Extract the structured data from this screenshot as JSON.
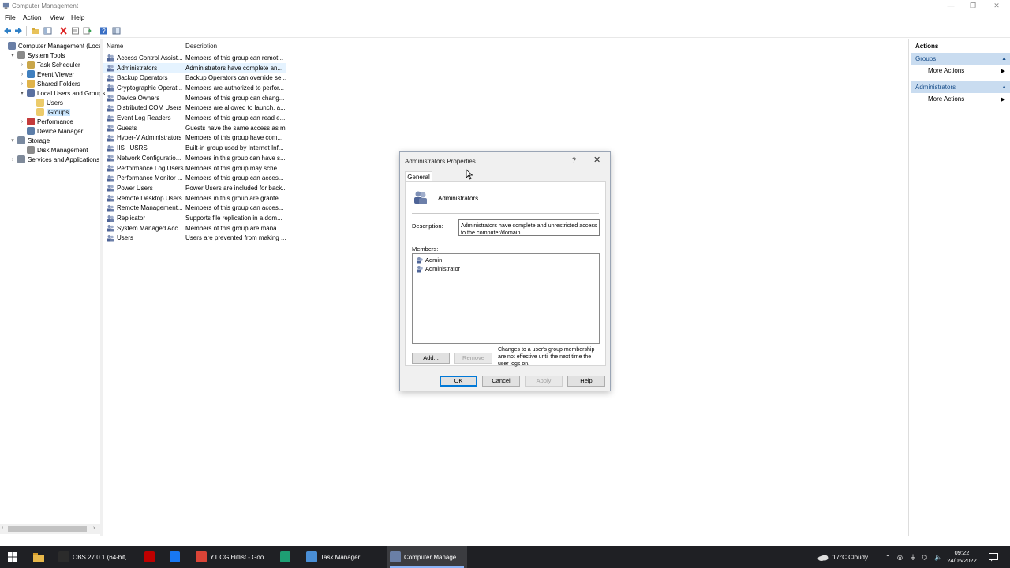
{
  "window": {
    "title": "Computer Management",
    "controls": [
      "—",
      "❐",
      "✕"
    ]
  },
  "menu": [
    "File",
    "Action",
    "View",
    "Help"
  ],
  "tree": [
    {
      "label": "Computer Management (Local",
      "indent": 0,
      "exp": "",
      "icon": "computer-icon"
    },
    {
      "label": "System Tools",
      "indent": 1,
      "exp": "▾",
      "icon": "tools-icon"
    },
    {
      "label": "Task Scheduler",
      "indent": 2,
      "exp": "›",
      "icon": "clock-icon"
    },
    {
      "label": "Event Viewer",
      "indent": 2,
      "exp": "›",
      "icon": "event-viewer-icon"
    },
    {
      "label": "Shared Folders",
      "indent": 2,
      "exp": "›",
      "icon": "shared-folder-icon"
    },
    {
      "label": "Local Users and Groups",
      "indent": 2,
      "exp": "▾",
      "icon": "users-icon"
    },
    {
      "label": "Users",
      "indent": 3,
      "exp": "",
      "icon": "folder-icon"
    },
    {
      "label": "Groups",
      "indent": 3,
      "exp": "",
      "icon": "folder-icon",
      "selected": true
    },
    {
      "label": "Performance",
      "indent": 2,
      "exp": "›",
      "icon": "performance-icon"
    },
    {
      "label": "Device Manager",
      "indent": 2,
      "exp": "",
      "icon": "device-manager-icon"
    },
    {
      "label": "Storage",
      "indent": 1,
      "exp": "▾",
      "icon": "storage-icon"
    },
    {
      "label": "Disk Management",
      "indent": 2,
      "exp": "",
      "icon": "disk-icon"
    },
    {
      "label": "Services and Applications",
      "indent": 1,
      "exp": "›",
      "icon": "services-icon"
    }
  ],
  "list": {
    "columns": [
      "Name",
      "Description"
    ],
    "rows": [
      {
        "name": "Access Control Assist...",
        "desc": "Members of this group can remot..."
      },
      {
        "name": "Administrators",
        "desc": "Administrators have complete an...",
        "selected": true
      },
      {
        "name": "Backup Operators",
        "desc": "Backup Operators can override se..."
      },
      {
        "name": "Cryptographic Operat...",
        "desc": "Members are authorized to perfor..."
      },
      {
        "name": "Device Owners",
        "desc": "Members of this group can chang..."
      },
      {
        "name": "Distributed COM Users",
        "desc": "Members are allowed to launch, a..."
      },
      {
        "name": "Event Log Readers",
        "desc": "Members of this group can read e..."
      },
      {
        "name": "Guests",
        "desc": "Guests have the same access as m..."
      },
      {
        "name": "Hyper-V Administrators",
        "desc": "Members of this group have com..."
      },
      {
        "name": "IIS_IUSRS",
        "desc": "Built-in group used by Internet Inf..."
      },
      {
        "name": "Network Configuratio...",
        "desc": "Members in this group can have s..."
      },
      {
        "name": "Performance Log Users",
        "desc": "Members of this group may sche..."
      },
      {
        "name": "Performance Monitor ...",
        "desc": "Members of this group can acces..."
      },
      {
        "name": "Power Users",
        "desc": "Power Users are included for back..."
      },
      {
        "name": "Remote Desktop Users",
        "desc": "Members in this group are grante..."
      },
      {
        "name": "Remote Management...",
        "desc": "Members of this group can acces..."
      },
      {
        "name": "Replicator",
        "desc": "Supports file replication in a dom..."
      },
      {
        "name": "System Managed Acc...",
        "desc": "Members of this group are mana..."
      },
      {
        "name": "Users",
        "desc": "Users are prevented from making ..."
      }
    ]
  },
  "actions": {
    "title": "Actions",
    "sections": [
      {
        "name": "Groups",
        "items": [
          "More Actions"
        ]
      },
      {
        "name": "Administrators",
        "items": [
          "More Actions"
        ]
      }
    ]
  },
  "dialog": {
    "title": "Administrators Properties",
    "help": "?",
    "close": "✕",
    "tab": "General",
    "group_name": "Administrators",
    "description_label": "Description:",
    "description_value": "Administrators have complete and unrestricted access to the computer/domain",
    "members_label": "Members:",
    "members": [
      "Admin",
      "Administrator"
    ],
    "add": "Add...",
    "remove": "Remove",
    "note": "Changes to a user's group membership are not effective until the next time the user logs on.",
    "ok": "OK",
    "cancel": "Cancel",
    "apply": "Apply",
    "helpbtn": "Help"
  },
  "taskbar": {
    "apps": [
      {
        "label": "OBS 27.0.1 (64-bit, ...",
        "icon": "obs-icon",
        "color": "#2b2b2b"
      },
      {
        "label": "",
        "icon": "filezilla-icon",
        "color": "#bf0000"
      },
      {
        "label": "",
        "icon": "chat-icon",
        "color": "#1877f2"
      },
      {
        "label": "YT CG Hitlist - Goo...",
        "icon": "chrome-icon",
        "color": "#db4437"
      },
      {
        "label": "",
        "icon": "editor-icon",
        "color": "#1e9e73"
      },
      {
        "label": "Task Manager",
        "icon": "task-manager-icon",
        "color": "#4a8fd6"
      },
      {
        "label": "Computer Manage...",
        "icon": "computer-management-icon",
        "color": "#6a7fa6",
        "active": true
      }
    ],
    "weather": "17°C  Cloudy",
    "time": "09:22",
    "date": "24/06/2022"
  }
}
